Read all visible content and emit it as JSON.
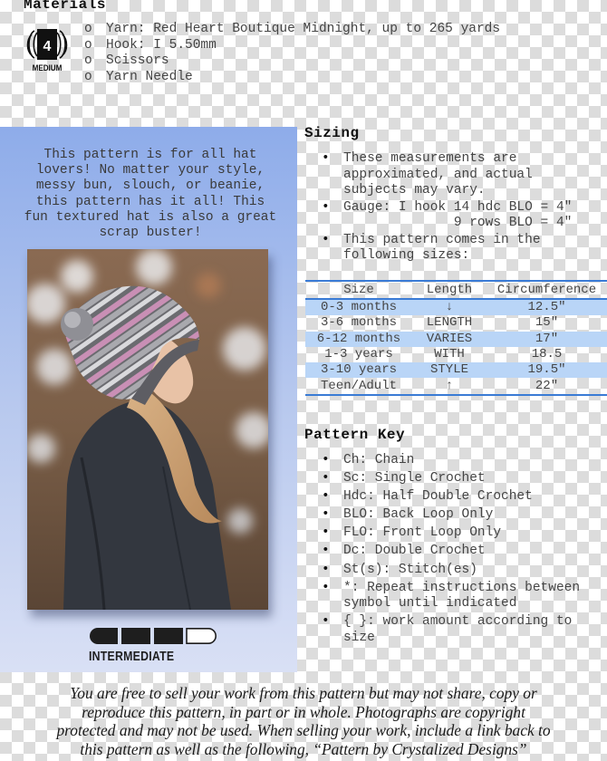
{
  "materials": {
    "title": "Materials",
    "yarn_weight_badge": {
      "number": "4",
      "label": "MEDIUM",
      "icon": "yarn-weight-icon"
    },
    "bullet_glyph": "o",
    "items": [
      "Yarn: Red Heart Boutique Midnight, up to 265 yards",
      "Hook: I 5.50mm",
      "Scissors",
      "Yarn Needle"
    ]
  },
  "promo": {
    "text": "This pattern is for all hat lovers! No matter your style, messy bun, slouch, or beanie, this pattern has it all! This fun textured hat is also a great scrap buster!",
    "text_lines": [
      "This pattern is for all hat",
      "lovers! No matter your style,",
      "messy bun, slouch, or beanie,",
      "this pattern has it all! This",
      "fun textured hat is also a great",
      "scrap buster!"
    ],
    "photo_alt": "Woman wearing a grey and pink striped slouchy crochet hat with pom-pom",
    "skill_level": {
      "label": "INTERMEDIATE",
      "filled": 3,
      "total": 4
    }
  },
  "sizing": {
    "title": "Sizing",
    "bullet_glyph": "•",
    "items": [
      {
        "lines": [
          "These measurements are",
          "approximated, and actual",
          "subjects may vary."
        ]
      },
      {
        "lines": [
          "Gauge: I hook 14 hdc BLO = 4\"",
          "              9 rows BLO = 4\""
        ]
      },
      {
        "lines": [
          "This pattern comes in the",
          "following sizes:"
        ]
      }
    ],
    "table": {
      "headers": [
        "Size",
        "Length",
        "Circumference"
      ],
      "rows": [
        [
          "0-3 months",
          "↓",
          "12.5″"
        ],
        [
          "3-6 months",
          "LENGTH",
          "15″"
        ],
        [
          "6-12 months",
          "VARIES",
          "17″"
        ],
        [
          "1-3 years",
          "WITH",
          "18.5"
        ],
        [
          "3-10 years",
          "STYLE",
          "19.5″"
        ],
        [
          "Teen/Adult",
          "↑",
          "22″"
        ]
      ],
      "accent_color": "#3a7bd5",
      "stripe_color": "#b9d5f7"
    }
  },
  "pattern_key": {
    "title": "Pattern Key",
    "bullet_glyph": "•",
    "items": [
      {
        "lines": [
          "Ch: Chain"
        ]
      },
      {
        "lines": [
          "Sc: Single Crochet"
        ]
      },
      {
        "lines": [
          "Hdc: Half Double Crochet"
        ]
      },
      {
        "lines": [
          "BLO: Back Loop Only"
        ]
      },
      {
        "lines": [
          "FLO: Front Loop Only"
        ]
      },
      {
        "lines": [
          "Dc: Double Crochet"
        ]
      },
      {
        "lines": [
          "St(s): Stitch(es)"
        ]
      },
      {
        "lines": [
          "*: Repeat instructions between",
          "symbol until indicated"
        ]
      },
      {
        "lines": [
          "{ }: work amount according to",
          "size"
        ]
      }
    ]
  },
  "footer": {
    "lines": [
      "You are free to sell your work from this pattern but may not share, copy or",
      "reproduce this pattern, in part or in whole. Photographs are copyright",
      "protected and may not be used. When selling your work, include a link back to",
      "this pattern as well as the following, “Pattern by Crystalized Designs”"
    ]
  }
}
